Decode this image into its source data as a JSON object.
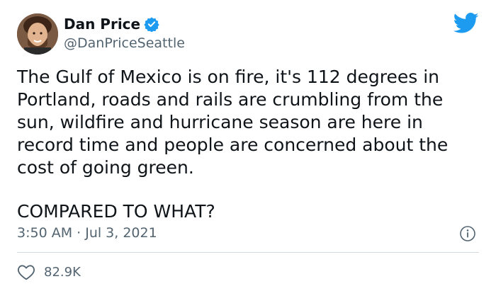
{
  "author": {
    "name": "Dan Price",
    "handle": "@DanPriceSeattle",
    "avatar": "avatar-photo",
    "verified_icon": "verified-badge-icon"
  },
  "platform_icon": "twitter-bird-icon",
  "tweet": {
    "paragraphs": [
      "The Gulf of Mexico is on fire, it's 112 degrees in Portland, roads and rails are crumbling from the sun, wildfire and hurricane season are here in record time and people are concerned about the cost of going green.",
      "COMPARED TO WHAT?"
    ],
    "timestamp": "3:50 AM · Jul 3, 2021"
  },
  "engagement": {
    "likes": "82.9K",
    "like_icon": "heart-icon"
  },
  "info_icon": "info-icon",
  "colors": {
    "text": "#0f1419",
    "muted": "#536471",
    "accent": "#1d9bf0",
    "divider": "#cfd9de"
  }
}
